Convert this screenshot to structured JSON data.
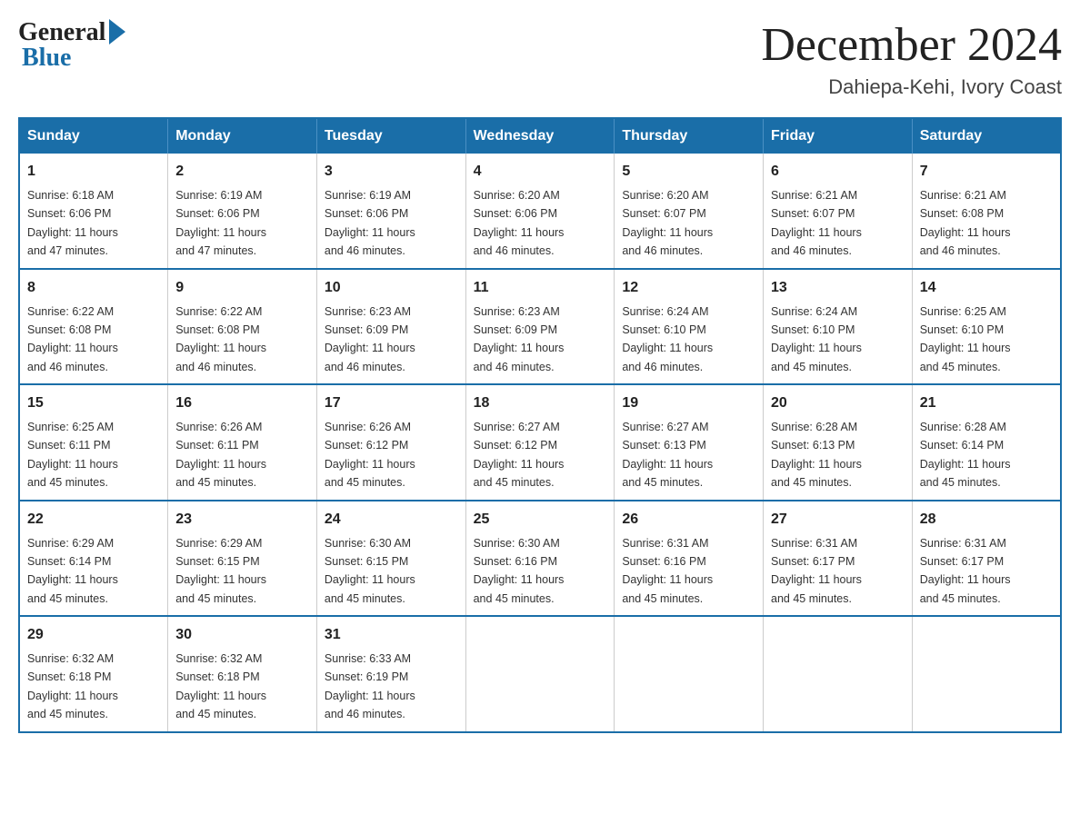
{
  "logo": {
    "general": "General",
    "blue": "Blue"
  },
  "title": "December 2024",
  "location": "Dahiepa-Kehi, Ivory Coast",
  "days_of_week": [
    "Sunday",
    "Monday",
    "Tuesday",
    "Wednesday",
    "Thursday",
    "Friday",
    "Saturday"
  ],
  "weeks": [
    [
      {
        "day": "1",
        "sunrise": "6:18 AM",
        "sunset": "6:06 PM",
        "daylight": "11 hours and 47 minutes."
      },
      {
        "day": "2",
        "sunrise": "6:19 AM",
        "sunset": "6:06 PM",
        "daylight": "11 hours and 47 minutes."
      },
      {
        "day": "3",
        "sunrise": "6:19 AM",
        "sunset": "6:06 PM",
        "daylight": "11 hours and 46 minutes."
      },
      {
        "day": "4",
        "sunrise": "6:20 AM",
        "sunset": "6:06 PM",
        "daylight": "11 hours and 46 minutes."
      },
      {
        "day": "5",
        "sunrise": "6:20 AM",
        "sunset": "6:07 PM",
        "daylight": "11 hours and 46 minutes."
      },
      {
        "day": "6",
        "sunrise": "6:21 AM",
        "sunset": "6:07 PM",
        "daylight": "11 hours and 46 minutes."
      },
      {
        "day": "7",
        "sunrise": "6:21 AM",
        "sunset": "6:08 PM",
        "daylight": "11 hours and 46 minutes."
      }
    ],
    [
      {
        "day": "8",
        "sunrise": "6:22 AM",
        "sunset": "6:08 PM",
        "daylight": "11 hours and 46 minutes."
      },
      {
        "day": "9",
        "sunrise": "6:22 AM",
        "sunset": "6:08 PM",
        "daylight": "11 hours and 46 minutes."
      },
      {
        "day": "10",
        "sunrise": "6:23 AM",
        "sunset": "6:09 PM",
        "daylight": "11 hours and 46 minutes."
      },
      {
        "day": "11",
        "sunrise": "6:23 AM",
        "sunset": "6:09 PM",
        "daylight": "11 hours and 46 minutes."
      },
      {
        "day": "12",
        "sunrise": "6:24 AM",
        "sunset": "6:10 PM",
        "daylight": "11 hours and 46 minutes."
      },
      {
        "day": "13",
        "sunrise": "6:24 AM",
        "sunset": "6:10 PM",
        "daylight": "11 hours and 45 minutes."
      },
      {
        "day": "14",
        "sunrise": "6:25 AM",
        "sunset": "6:10 PM",
        "daylight": "11 hours and 45 minutes."
      }
    ],
    [
      {
        "day": "15",
        "sunrise": "6:25 AM",
        "sunset": "6:11 PM",
        "daylight": "11 hours and 45 minutes."
      },
      {
        "day": "16",
        "sunrise": "6:26 AM",
        "sunset": "6:11 PM",
        "daylight": "11 hours and 45 minutes."
      },
      {
        "day": "17",
        "sunrise": "6:26 AM",
        "sunset": "6:12 PM",
        "daylight": "11 hours and 45 minutes."
      },
      {
        "day": "18",
        "sunrise": "6:27 AM",
        "sunset": "6:12 PM",
        "daylight": "11 hours and 45 minutes."
      },
      {
        "day": "19",
        "sunrise": "6:27 AM",
        "sunset": "6:13 PM",
        "daylight": "11 hours and 45 minutes."
      },
      {
        "day": "20",
        "sunrise": "6:28 AM",
        "sunset": "6:13 PM",
        "daylight": "11 hours and 45 minutes."
      },
      {
        "day": "21",
        "sunrise": "6:28 AM",
        "sunset": "6:14 PM",
        "daylight": "11 hours and 45 minutes."
      }
    ],
    [
      {
        "day": "22",
        "sunrise": "6:29 AM",
        "sunset": "6:14 PM",
        "daylight": "11 hours and 45 minutes."
      },
      {
        "day": "23",
        "sunrise": "6:29 AM",
        "sunset": "6:15 PM",
        "daylight": "11 hours and 45 minutes."
      },
      {
        "day": "24",
        "sunrise": "6:30 AM",
        "sunset": "6:15 PM",
        "daylight": "11 hours and 45 minutes."
      },
      {
        "day": "25",
        "sunrise": "6:30 AM",
        "sunset": "6:16 PM",
        "daylight": "11 hours and 45 minutes."
      },
      {
        "day": "26",
        "sunrise": "6:31 AM",
        "sunset": "6:16 PM",
        "daylight": "11 hours and 45 minutes."
      },
      {
        "day": "27",
        "sunrise": "6:31 AM",
        "sunset": "6:17 PM",
        "daylight": "11 hours and 45 minutes."
      },
      {
        "day": "28",
        "sunrise": "6:31 AM",
        "sunset": "6:17 PM",
        "daylight": "11 hours and 45 minutes."
      }
    ],
    [
      {
        "day": "29",
        "sunrise": "6:32 AM",
        "sunset": "6:18 PM",
        "daylight": "11 hours and 45 minutes."
      },
      {
        "day": "30",
        "sunrise": "6:32 AM",
        "sunset": "6:18 PM",
        "daylight": "11 hours and 45 minutes."
      },
      {
        "day": "31",
        "sunrise": "6:33 AM",
        "sunset": "6:19 PM",
        "daylight": "11 hours and 46 minutes."
      },
      null,
      null,
      null,
      null
    ]
  ],
  "labels": {
    "sunrise": "Sunrise:",
    "sunset": "Sunset:",
    "daylight": "Daylight:"
  }
}
